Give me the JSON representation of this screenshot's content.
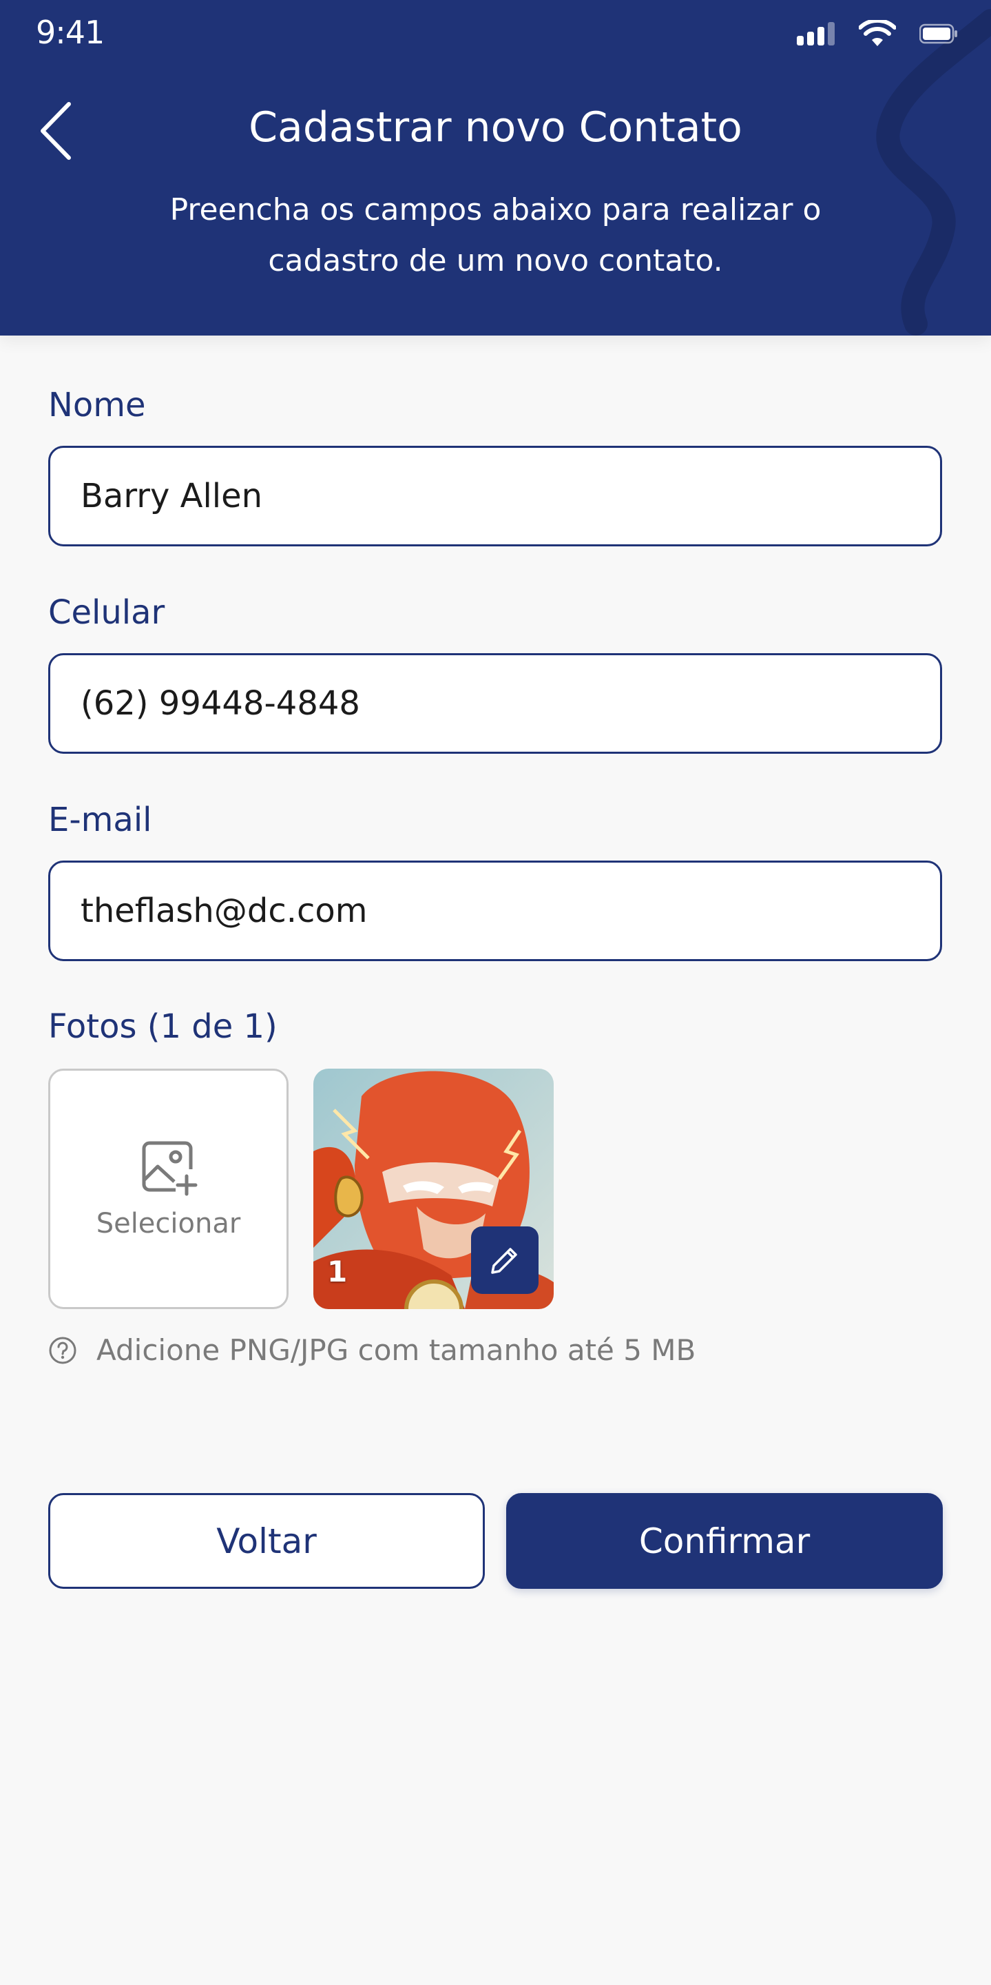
{
  "status_bar": {
    "time": "9:41",
    "icons": [
      "signal-icon",
      "wifi-icon",
      "battery-icon"
    ]
  },
  "header": {
    "back_icon": "chevron-left-icon",
    "title": "Cadastrar novo Contato",
    "subtitle": "Preencha os campos abaixo para realizar o cadastro de um novo contato."
  },
  "form": {
    "name": {
      "label": "Nome",
      "value": "Barry Allen"
    },
    "phone": {
      "label": "Celular",
      "value": "(62) 99448-4848"
    },
    "email": {
      "label": "E-mail",
      "value": "theflash@dc.com"
    },
    "photos": {
      "label": "Fotos (1 de 1)",
      "select_label": "Selecionar",
      "select_icon": "image-add-icon",
      "thumbnail_index": "1",
      "edit_icon": "pencil-icon",
      "hint": "Adicione PNG/JPG com tamanho até 5 MB",
      "hint_icon": "help-circle-icon"
    }
  },
  "actions": {
    "back_label": "Voltar",
    "confirm_label": "Confirmar"
  },
  "colors": {
    "primary": "#1f3377",
    "background": "#f8f8f8",
    "muted_text": "#7a7a7a",
    "border_muted": "#c9c9c9"
  }
}
